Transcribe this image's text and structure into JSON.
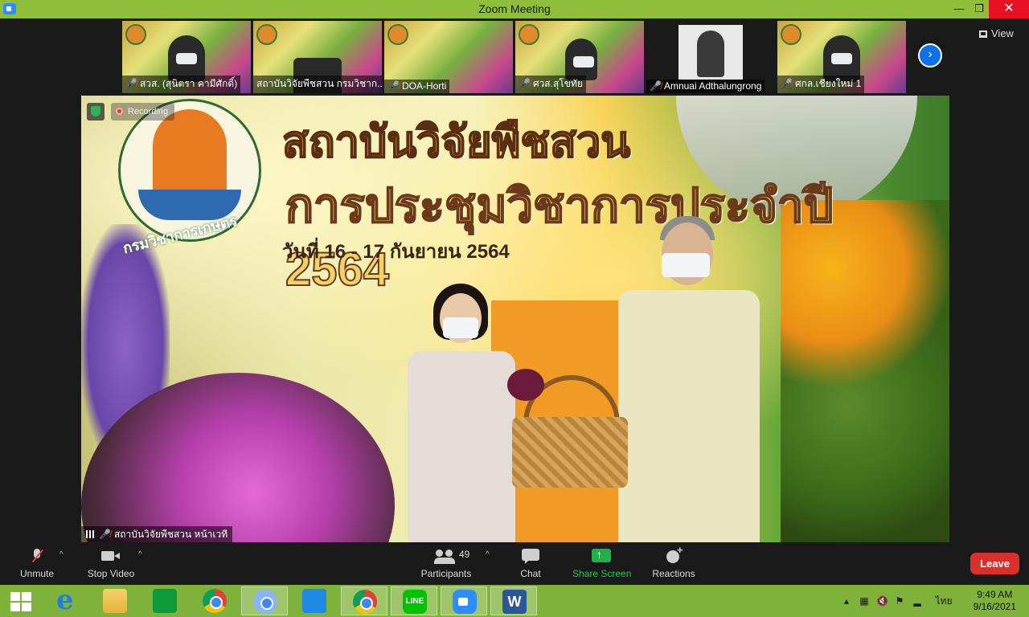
{
  "window": {
    "title": "Zoom Meeting",
    "min_glyph": "—",
    "max_glyph": "❐",
    "close_glyph": "✕"
  },
  "filmstrip": {
    "tiles": [
      {
        "label": "สวส. (สุนิตรา คามีศักดิ์)",
        "muted": true,
        "has_video": true
      },
      {
        "label": "สถาบันวิจัยพืชสวน กรมวิชาก...",
        "muted": false,
        "has_video": true
      },
      {
        "label": "DOA-Horti",
        "muted": true,
        "has_video": true
      },
      {
        "label": "ศวส.สุโขทัย",
        "muted": true,
        "has_video": true
      },
      {
        "label": "Amnuai Adthalungrong",
        "muted": true,
        "has_video": true
      },
      {
        "label": "ศกล.เชียงใหม่ 1",
        "muted": true,
        "has_video": true
      }
    ],
    "next_glyph": "›",
    "view_label": "View"
  },
  "main_video": {
    "recording_label": "Recording",
    "title_line1": "สถาบันวิจัยพืชสวน",
    "title_line2": "การประชุมวิชาการประจำปี 2564",
    "date_line": "วันที่ 16 - 17 กันยายน 2564",
    "emblem_caption": "กรมวิชาการเกษตร",
    "participant_label": "สถาบันวิจัยพืชสวน หน้าเวที",
    "participant_muted": true
  },
  "toolbar": {
    "unmute": "Unmute",
    "stop_video": "Stop Video",
    "participants": "Participants",
    "participants_count": "49",
    "chat": "Chat",
    "share_screen": "Share Screen",
    "reactions": "Reactions",
    "leave": "Leave",
    "caret": "^"
  },
  "taskbar": {
    "apps": [
      "start",
      "internet-explorer",
      "file-explorer",
      "store",
      "chrome",
      "chrome",
      "meet",
      "line",
      "zoom",
      "word"
    ],
    "line_text": "LINE",
    "word_text": "W",
    "lang": "ไทย",
    "time": "9:49 AM",
    "date": "9/16/2021"
  },
  "colors": {
    "titlebar": "#8fbe3b",
    "taskbar": "#7fb23a",
    "leave": "#d9302b",
    "share": "#20b14c"
  }
}
